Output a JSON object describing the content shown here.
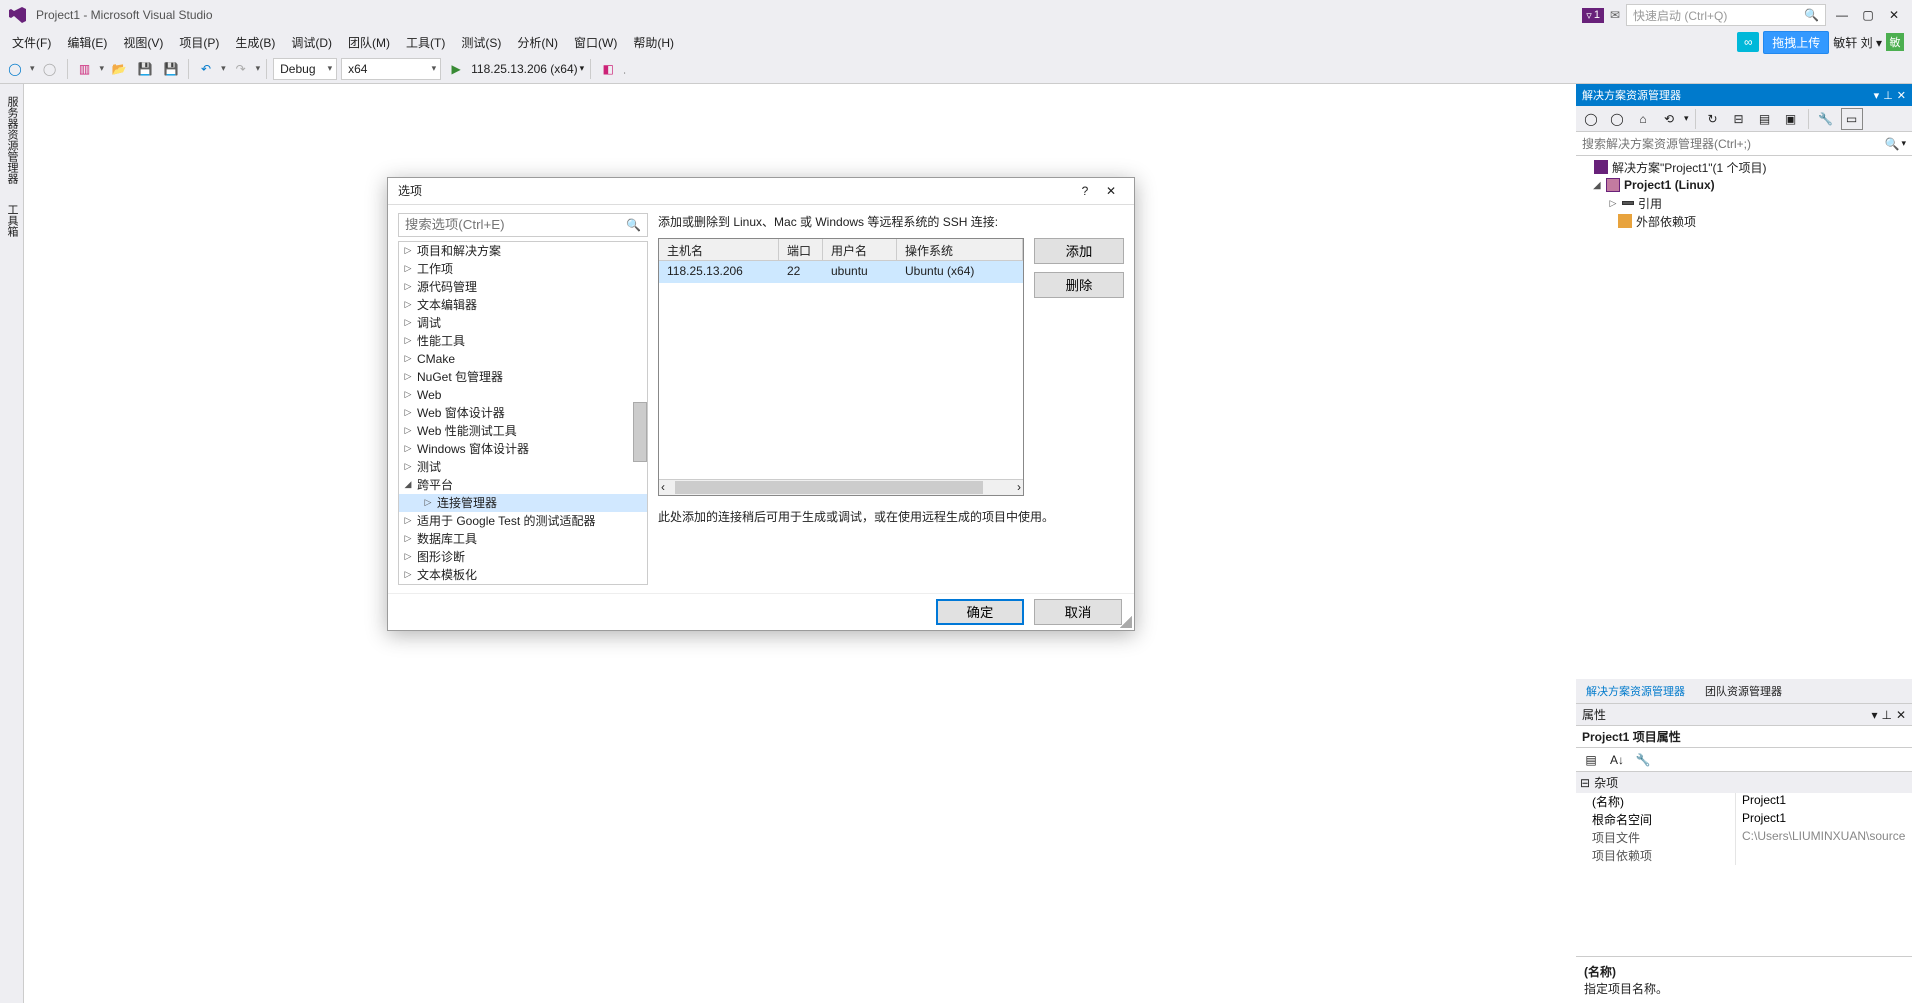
{
  "titlebar": {
    "title": "Project1 - Microsoft Visual Studio",
    "notification_count": "1",
    "quicklaunch_placeholder": "快速启动 (Ctrl+Q)"
  },
  "menubar": {
    "items": [
      "文件(F)",
      "编辑(E)",
      "视图(V)",
      "项目(P)",
      "生成(B)",
      "调试(D)",
      "团队(M)",
      "工具(T)",
      "测试(S)",
      "分析(N)",
      "窗口(W)",
      "帮助(H)"
    ],
    "upload_btn": "拖拽上传",
    "username": "敏轩 刘",
    "user_initial": "敏"
  },
  "toolbar": {
    "config": "Debug",
    "platform": "x64",
    "target": "118.25.13.206 (x64)"
  },
  "left_tabs": [
    "服务器资源管理器",
    "工具箱"
  ],
  "solution_explorer": {
    "title": "解决方案资源管理器",
    "search_placeholder": "搜索解决方案资源管理器(Ctrl+;)",
    "root": "解决方案\"Project1\"(1 个项目)",
    "project": "Project1 (Linux)",
    "refs": "引用",
    "ext": "外部依赖项",
    "tab_active": "解决方案资源管理器",
    "tab_other": "团队资源管理器"
  },
  "properties": {
    "title": "属性",
    "subject": "Project1 项目属性",
    "category": "杂项",
    "rows": [
      {
        "k": "(名称)",
        "v": "Project1"
      },
      {
        "k": "根命名空间",
        "v": "Project1"
      },
      {
        "k": "项目文件",
        "v": "C:\\Users\\LIUMINXUAN\\source"
      },
      {
        "k": "项目依赖项",
        "v": ""
      }
    ],
    "desc_name": "(名称)",
    "desc_text": "指定项目名称。"
  },
  "dialog": {
    "title": "选项",
    "search_placeholder": "搜索选项(Ctrl+E)",
    "tree": [
      "项目和解决方案",
      "工作项",
      "源代码管理",
      "文本编辑器",
      "调试",
      "性能工具",
      "CMake",
      "NuGet 包管理器",
      "Web",
      "Web 窗体设计器",
      "Web 性能测试工具",
      "Windows 窗体设计器",
      "测试",
      "跨平台",
      "连接管理器",
      "适用于 Google Test 的测试适配器",
      "数据库工具",
      "图形诊断",
      "文本模板化"
    ],
    "tree_expanded_index": 13,
    "tree_selected_index": 14,
    "desc": "添加或删除到 Linux、Mac 或 Windows 等远程系统的 SSH 连接:",
    "columns": {
      "host": "主机名",
      "port": "端口",
      "user": "用户名",
      "os": "操作系统"
    },
    "rows": [
      {
        "host": "118.25.13.206",
        "port": "22",
        "user": "ubuntu",
        "os": "Ubuntu (x64)"
      }
    ],
    "btn_add": "添加",
    "btn_delete": "删除",
    "note": "此处添加的连接稍后可用于生成或调试，或在使用远程生成的项目中使用。",
    "btn_ok": "确定",
    "btn_cancel": "取消"
  }
}
